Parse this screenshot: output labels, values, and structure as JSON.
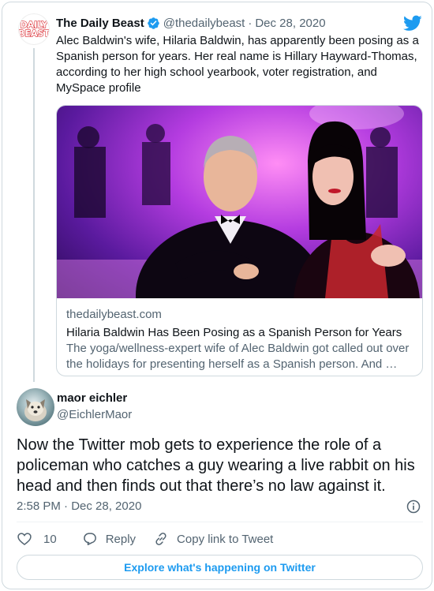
{
  "parent_tweet": {
    "avatar_logo": [
      "DAILY",
      "BEAST"
    ],
    "author_name": "The Daily Beast",
    "handle": "@thedailybeast",
    "separator": "·",
    "date": "Dec 28, 2020",
    "text": "Alec Baldwin's wife, Hilaria Baldwin, has apparently been posing as a Spanish person for years. Her real name is Hillary Hayward-Thomas, according to her high school yearbook, voter registration, and MySpace profile",
    "link_card": {
      "domain": "thedailybeast.com",
      "title": "Hilaria Baldwin Has Been Posing as a Spanish Person for Years",
      "description": "The yoga/wellness-expert wife of Alec Baldwin got called out over the holidays for presenting herself as a Spanish person. And …"
    }
  },
  "main_tweet": {
    "author_name": "maor eichler",
    "handle": "@EichlerMaor",
    "text": "Now the Twitter mob gets to experience the role of a policeman who catches a guy wearing a live rabbit on his head and then finds out that there’s no law against it.",
    "timestamp": "2:58 PM · Dec 28, 2020"
  },
  "actions": {
    "like_count": "10",
    "reply_label": "Reply",
    "copy_link_label": "Copy link to Tweet"
  },
  "explore_label": "Explore what's happening on Twitter",
  "colors": {
    "brand_blue": "#1d9bf0",
    "text_primary": "#0f1419",
    "text_secondary": "#536471",
    "border": "#cfd9de",
    "daily_beast_red": "#d9242b"
  },
  "icons": {
    "verified": "verified-badge-icon",
    "twitter": "twitter-bird-icon",
    "info": "info-icon",
    "like": "heart-icon",
    "reply": "reply-bubble-icon",
    "copy_link": "link-icon"
  }
}
